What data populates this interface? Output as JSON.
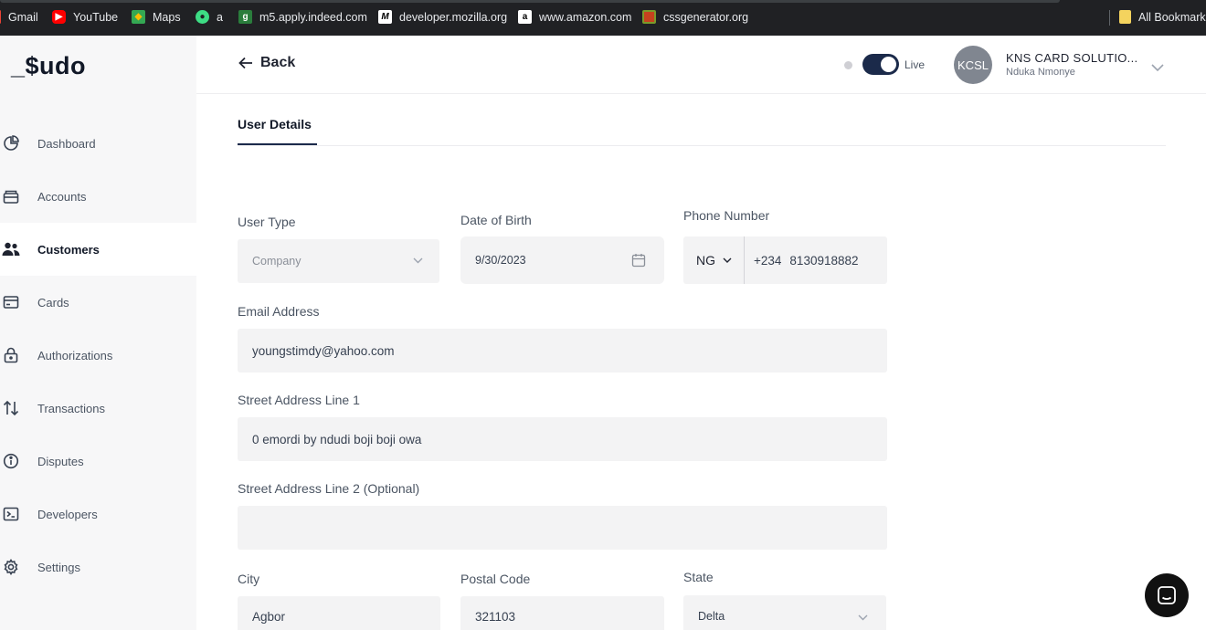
{
  "bookmarks": [
    {
      "label": "Gmail",
      "icon": "gmail-icon"
    },
    {
      "label": "YouTube",
      "icon": "youtube-icon"
    },
    {
      "label": "Maps",
      "icon": "maps-icon"
    },
    {
      "label": "a",
      "icon": "android-icon"
    },
    {
      "label": "m5.apply.indeed.com",
      "icon": "indeed-icon"
    },
    {
      "label": "developer.mozilla.org",
      "icon": "mdn-icon"
    },
    {
      "label": "www.amazon.com",
      "icon": "amazon-icon"
    },
    {
      "label": "cssgenerator.org",
      "icon": "cssgenerator-icon"
    },
    {
      "label": "All Bookmarks",
      "icon": "folder-icon"
    }
  ],
  "logo": "_$udo",
  "sidebar": {
    "items": [
      {
        "label": "Dashboard",
        "icon": "pie-chart-icon",
        "active": false
      },
      {
        "label": "Accounts",
        "icon": "wallet-icon",
        "active": false
      },
      {
        "label": "Customers",
        "icon": "users-icon",
        "active": true
      },
      {
        "label": "Cards",
        "icon": "card-icon",
        "active": false
      },
      {
        "label": "Authorizations",
        "icon": "lock-icon",
        "active": false
      },
      {
        "label": "Transactions",
        "icon": "transfer-arrows-icon",
        "active": false
      },
      {
        "label": "Disputes",
        "icon": "info-circle-icon",
        "active": false
      },
      {
        "label": "Developers",
        "icon": "terminal-icon",
        "active": false
      },
      {
        "label": "Settings",
        "icon": "gear-icon",
        "active": false
      }
    ]
  },
  "header": {
    "back_label": "Back",
    "live_label": "Live",
    "live_enabled": true,
    "avatar_initials": "KCSL",
    "account_name": "KNS CARD SOLUTIO...",
    "account_user": "Nduka Nmonye"
  },
  "tabs": [
    {
      "label": "User Details",
      "active": true
    }
  ],
  "form": {
    "user_type": {
      "label": "User Type",
      "value": "Company"
    },
    "dob": {
      "label": "Date of Birth",
      "value": "9/30/2023"
    },
    "phone": {
      "label": "Phone Number",
      "country": "NG",
      "dial_code": "+234",
      "number": "8130918882"
    },
    "email": {
      "label": "Email Address",
      "value": "youngstimdy@yahoo.com"
    },
    "street1": {
      "label": "Street Address Line 1",
      "value": "0 emordi by ndudi boji boji owa"
    },
    "street2": {
      "label": "Street Address Line 2 (Optional)",
      "value": ""
    },
    "city": {
      "label": "City",
      "value": "Agbor"
    },
    "postal": {
      "label": "Postal Code",
      "value": "321103"
    },
    "state": {
      "label": "State",
      "value": "Delta"
    }
  },
  "colors": {
    "sidebar_bg": "#f7f7f8",
    "field_bg": "#f3f3f4",
    "accent_navy": "#1b2a4a",
    "avatar_bg": "#808690"
  }
}
